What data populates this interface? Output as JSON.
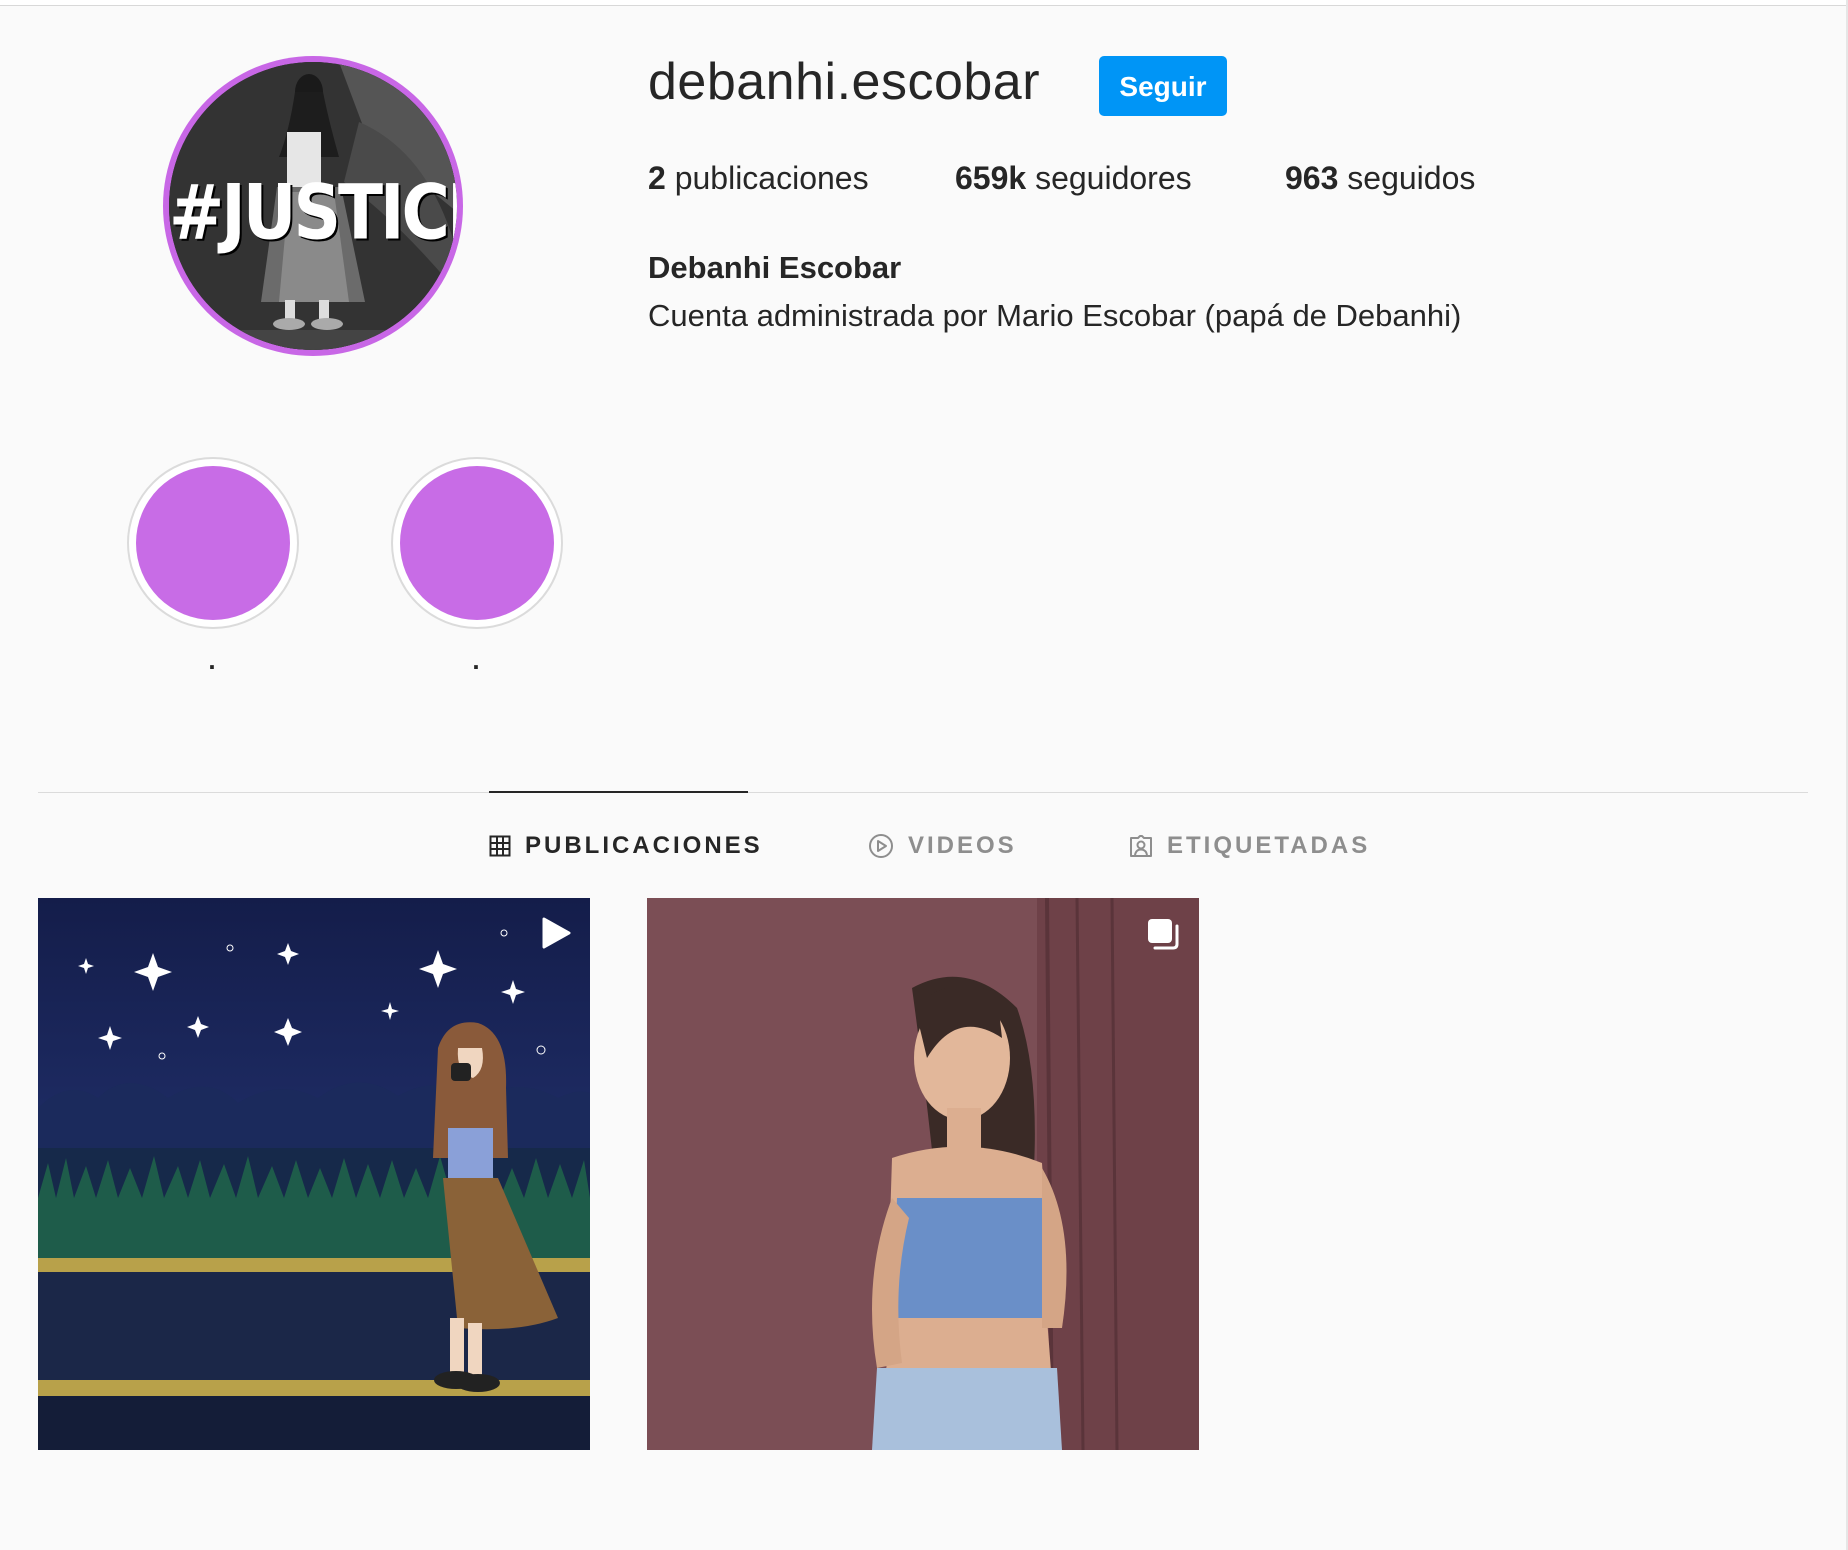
{
  "profile": {
    "username": "debanhi.escobar",
    "follow_label": "Seguir",
    "avatar_text": "#JUSTICIA",
    "stats": {
      "posts_count": "2",
      "posts_label": "publicaciones",
      "followers_count": "659k",
      "followers_label": "seguidores",
      "following_count": "963",
      "following_label": "seguidos"
    },
    "full_name": "Debanhi Escobar",
    "bio": "Cuenta administrada por Mario Escobar (papá de Debanhi)"
  },
  "highlights": [
    {
      "label": ".",
      "color": "#c86ce6"
    },
    {
      "label": ".",
      "color": "#c86ce6"
    }
  ],
  "tabs": [
    {
      "label": "PUBLICACIONES",
      "icon": "grid-icon",
      "active": true
    },
    {
      "label": "VIDEOS",
      "icon": "play-circle-icon",
      "active": false
    },
    {
      "label": "ETIQUETADAS",
      "icon": "tagged-user-icon",
      "active": false
    }
  ],
  "posts": [
    {
      "type": "video",
      "badge_icon": "reel-play-icon",
      "description_icon": "illustration-night-sky"
    },
    {
      "type": "carousel",
      "badge_icon": "carousel-icon",
      "description_icon": "photo-portrait"
    }
  ],
  "colors": {
    "follow_button": "#0095f6",
    "highlight_ring": "#c86ce6",
    "text": "#262626",
    "muted": "#8e8e8e"
  }
}
